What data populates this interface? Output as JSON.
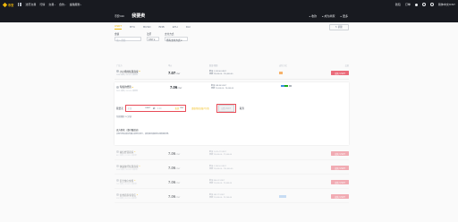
{
  "topbar": {
    "brand": "币安",
    "nav": [
      "法币交易",
      "行情",
      "交易",
      "合约",
      "金融服务"
    ],
    "right_items": [
      "钱包",
      "订单",
      "简体中文/CNY"
    ]
  },
  "subheader": {
    "brand": "币安C2C",
    "title": "我要卖",
    "links": [
      "收款",
      "成为商家",
      "更多"
    ]
  },
  "coins": {
    "tabs": [
      "USDT",
      "BTC",
      "BUSD",
      "BNB",
      "ETH",
      "DAI"
    ],
    "active_index": 0
  },
  "toolbar": {
    "refresh": "刷新"
  },
  "filters": {
    "amount_label": "金额",
    "amount_placeholder": "输入金额",
    "fiat_label": "法币",
    "fiat_value": "CNY",
    "pay_label": "支付方式",
    "pay_value": "所有支付方式"
  },
  "columns": [
    "广告方",
    "单价",
    "数量/限额",
    "支付方式",
    "交易"
  ],
  "listings": [
    {
      "name": "小小熊的优质商家",
      "stats": "1386 成单 | 98.50% 成单率",
      "price": "7.07",
      "unit": "CNY",
      "qty": "数量 1,741.90 USDT",
      "limit": "限额 ¥3,000.00 - ¥10,000.00",
      "action": "出售 USDT",
      "faded": false
    },
    {
      "name": "专属的经营",
      "stats": "2461 成单 | 99.10% 成单率",
      "price": "7.06",
      "unit": "CNY",
      "qty": "数量 598.84 USDT",
      "limit": "限额 ¥1,000.00 - ¥4,000.00",
      "action": "出售 USDT",
      "faded": false
    },
    {
      "name": "诚信经营商家",
      "stats": "842 成单 | 97.30% 成单率",
      "price": "7.06",
      "unit": "CNY",
      "qty": "数量 1,015.47 USDT",
      "limit": "限额 ¥3,000.00 - ¥7,000.00",
      "action": "出售 USDT",
      "faded": true
    },
    {
      "name": "快速放行优质商家",
      "stats": "1106 成单 | 98.90% 成单率",
      "price": "7.06",
      "unit": "CNY",
      "qty": "数量 2,118.10 USDT",
      "limit": "限额 ¥5,000.00 - ¥14,000.00",
      "action": "出售 USDT",
      "faded": true
    },
    {
      "name": "安全放心交易",
      "stats": "705 成单 | 96.80% 成单率",
      "price": "7.06",
      "unit": "CNY",
      "qty": "数量 804.01 USDT",
      "limit": "限额 ¥2,000.00 - ¥5,600.00",
      "action": "出售 USDT",
      "faded": true
    },
    {
      "name": "信誉商家专营店",
      "stats": "398 成单 | 95.70% 成单率",
      "price": "7.06",
      "unit": "CNY",
      "qty": "数量 463.27 USDT",
      "limit": "限额 ¥1,000.00 - ¥3,200.00",
      "action": "出售 USDT",
      "faded": true
    }
  ],
  "expanded": {
    "name": "专属的经营",
    "stats": "2461 成单 | 99.10% 成单率",
    "price": "7.06",
    "unit": "CNY",
    "qty": "数量 598.84 USDT",
    "limit": "限额 ¥1,000.00 - ¥4,000.00",
    "sell_label": "我要卖",
    "sell_placeholder": "全部",
    "sell_unit_all": "全部",
    "sell_unit": "USDT",
    "sep": "⇌",
    "receive_placeholder": "0.00",
    "receive_unit": "CNY",
    "note": "请使用实名账户付款",
    "confirm": "出售USDT",
    "cancel": "取消",
    "small_info": "付款期限 15 分钟",
    "terms_title": "卖方条款（请仔细阅读）",
    "terms_text": "买家付款后请及时确认收款并放行，如有疑问请联系在线客服处理。"
  },
  "colors": {
    "brand": "#f0b90b",
    "sell": "#ea6b7a",
    "dark": "#181a20"
  }
}
